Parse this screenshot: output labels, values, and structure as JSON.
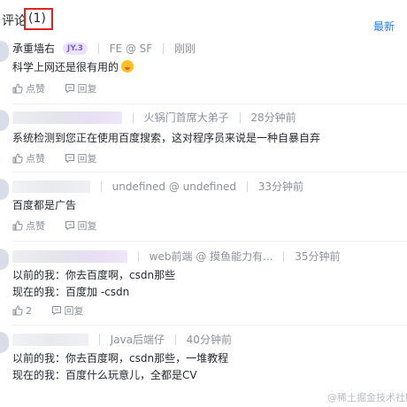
{
  "header": {
    "title": "评论",
    "count": "(1)",
    "sort_latest": "最新"
  },
  "comments": [
    {
      "author": "承重墙右",
      "badge": "JY.3",
      "role": "FE @ SF",
      "time": "刚刚",
      "lines": [
        "科学上网还是很有用的"
      ],
      "like": "点赞",
      "reply": "回复"
    },
    {
      "role": "火锅门首席大弟子",
      "time": "28分钟前",
      "lines": [
        "系统检测到您正在使用百度搜索，这对程序员来说是一种自暴自弃"
      ],
      "like": "点赞",
      "reply": "回复"
    },
    {
      "role": "undefined @ undefined",
      "time": "33分钟前",
      "lines": [
        "百度都是广告"
      ],
      "like": "点赞",
      "reply": "回复"
    },
    {
      "role": "web前端 @ 摸鱼能力有...",
      "time": "35分钟前",
      "lines": [
        "以前的我：你去百度啊，csdn那些",
        "现在的我：百度加 -csdn"
      ],
      "like": "2",
      "reply": "回复"
    },
    {
      "role": "Java后端仔",
      "time": "40分钟前",
      "lines": [
        "以前的我：你去百度啊，csdn那些，一堆教程",
        "现在的我：百度什么玩意儿，全都是CV"
      ],
      "like": "点赞",
      "reply": "回复"
    }
  ],
  "watermark": "@稀土掘金技术社区",
  "colors": {
    "accent": "#1e80ff",
    "highlight_box": "#e1251b",
    "muted": "#8a919f"
  }
}
